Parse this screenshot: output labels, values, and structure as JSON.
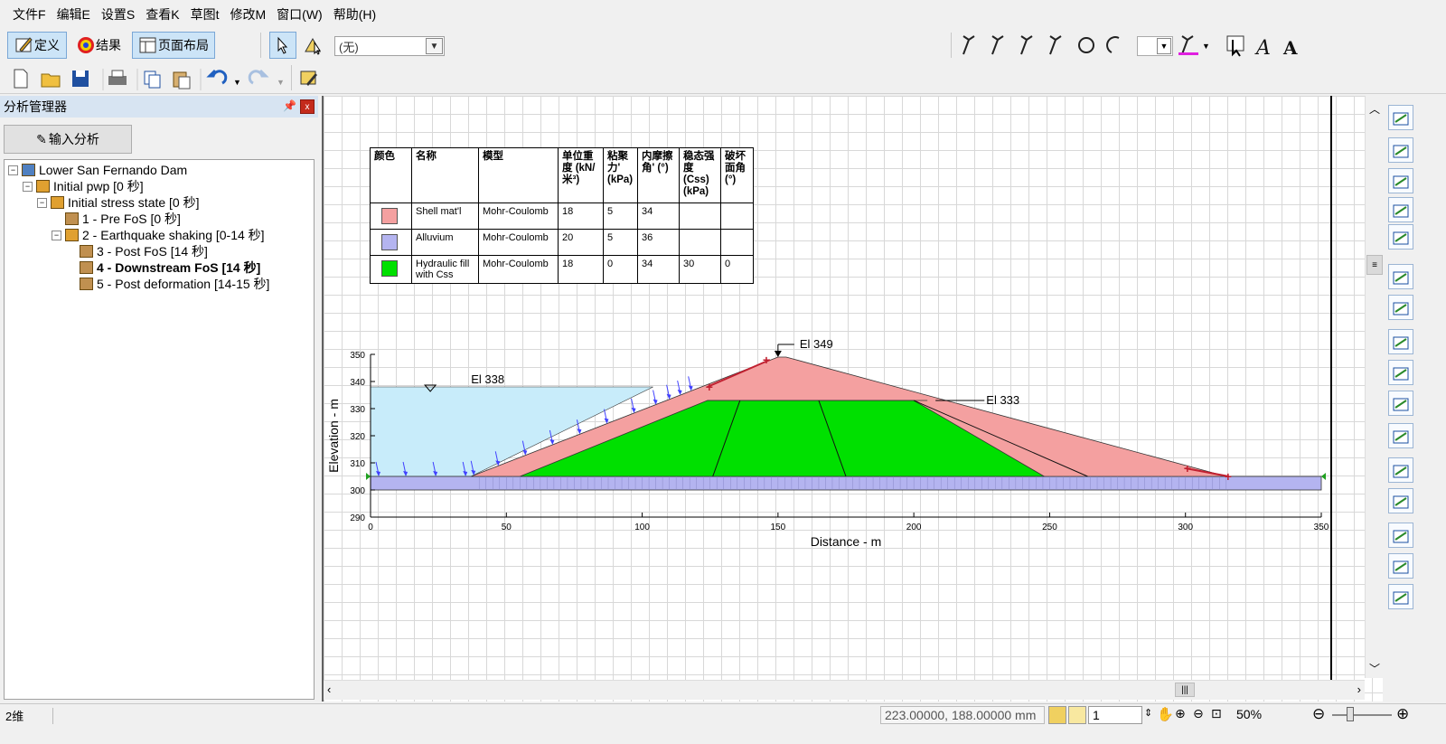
{
  "menu": [
    "文件F",
    "编辑E",
    "设置S",
    "查看K",
    "草图t",
    "修改M",
    "窗口(W)",
    "帮助(H)"
  ],
  "toolbar": {
    "define_label": "定义",
    "results_label": "结果",
    "layout_label": "页面布局",
    "combo_value": "(无)"
  },
  "panel": {
    "title": "分析管理器",
    "pin": "ꟻ",
    "close": "x",
    "input_button": "输入分析"
  },
  "tree": [
    {
      "label": "Lower San Fernando Dam",
      "level": 0,
      "expander": "−"
    },
    {
      "label": "Initial pwp [0 秒]",
      "level": 1,
      "expander": "−"
    },
    {
      "label": "Initial stress state [0 秒]",
      "level": 2,
      "expander": "−"
    },
    {
      "label": "1 - Pre FoS [0 秒]",
      "level": 3,
      "expander": ""
    },
    {
      "label": "2 - Earthquake shaking [0-14 秒]",
      "level": 3,
      "expander": "−"
    },
    {
      "label": "3 - Post FoS [14 秒]",
      "level": 4,
      "expander": ""
    },
    {
      "label": "4 - Downstream FoS [14 秒]",
      "level": 4,
      "expander": "",
      "bold": true
    },
    {
      "label": "5 - Post deformation [14-15 秒]",
      "level": 4,
      "expander": ""
    }
  ],
  "materials": {
    "headers": [
      "颜色",
      "名称",
      "模型",
      "单位重度 (kN/米³)",
      "粘聚力' (kPa)",
      "内摩擦角' (°)",
      "稳态强度 (Css) (kPa)",
      "破坏面角 (°)"
    ],
    "rows": [
      {
        "color": "#f4a0a0",
        "name": "Shell mat'l",
        "model": "Mohr-Coulomb",
        "weight": "18",
        "cohesion": "5",
        "phi": "34",
        "css": "",
        "angle": ""
      },
      {
        "color": "#b4b4f0",
        "name": "Alluvium",
        "model": "Mohr-Coulomb",
        "weight": "20",
        "cohesion": "5",
        "phi": "36",
        "css": "",
        "angle": ""
      },
      {
        "color": "#00e000",
        "name": "Hydraulic fill with Css",
        "model": "Mohr-Coulomb",
        "weight": "18",
        "cohesion": "0",
        "phi": "34",
        "css": "30",
        "angle": "0"
      }
    ]
  },
  "chart_data": {
    "type": "diagram",
    "xlabel": "Distance - m",
    "ylabel": "Elevation - m",
    "xlim": [
      0,
      350
    ],
    "ylim": [
      290,
      350
    ],
    "x_ticks": [
      0,
      50,
      100,
      150,
      200,
      250,
      300,
      350
    ],
    "y_ticks": [
      290,
      300,
      310,
      320,
      330,
      340,
      350
    ],
    "annotations": [
      {
        "text": "El 349",
        "x": 150,
        "y": 349
      },
      {
        "text": "El 338",
        "x": 22,
        "y": 338
      },
      {
        "text": "El 333",
        "x": 208,
        "y": 333
      }
    ]
  },
  "status": {
    "mode": "2维",
    "coords": "223.00000, 188.00000 mm",
    "level": "1",
    "zoom": "50%"
  },
  "colors": {
    "shell": "#f4a0a0",
    "alluvium": "#b4b4f0",
    "fill": "#00e000",
    "water": "#c8ecfa",
    "arrows": "#4040ff"
  }
}
